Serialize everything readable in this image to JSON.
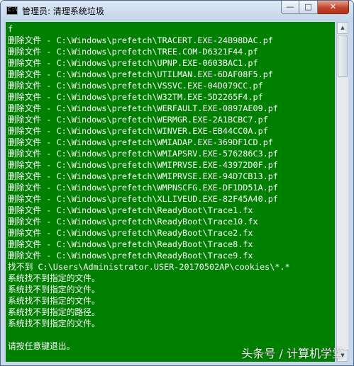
{
  "window": {
    "title": "管理员: 清理系统垃圾",
    "icon_text": "C:\\",
    "icon": "console-window-icon",
    "controls": {
      "minimize": "—",
      "maximize": "□",
      "close": "✕"
    }
  },
  "console": {
    "background_color": "#008000",
    "text_color": "#ffffff",
    "lines": [
      "f",
      "删除文件 - C:\\Windows\\prefetch\\TRACERT.EXE-24B98DAC.pf",
      "删除文件 - C:\\Windows\\prefetch\\TREE.COM-D6321F44.pf",
      "删除文件 - C:\\Windows\\prefetch\\UPNP.EXE-0603BAC1.pf",
      "删除文件 - C:\\Windows\\prefetch\\UTILMAN.EXE-6DAF08F5.pf",
      "删除文件 - C:\\Windows\\prefetch\\VSSVC.EXE-04D079CC.pf",
      "删除文件 - C:\\Windows\\prefetch\\W32TM.EXE-5D2265F4.pf",
      "删除文件 - C:\\Windows\\prefetch\\WERFAULT.EXE-0897AE09.pf",
      "删除文件 - C:\\Windows\\prefetch\\WERMGR.EXE-2A1BCBC7.pf",
      "删除文件 - C:\\Windows\\prefetch\\WINVER.EXE-EB44CC0A.pf",
      "删除文件 - C:\\Windows\\prefetch\\WMIADAP.EXE-369DF1CD.pf",
      "删除文件 - C:\\Windows\\prefetch\\WMIAPSRV.EXE-576286C3.pf",
      "删除文件 - C:\\Windows\\prefetch\\WMIPRVSE.EXE-43972D0F.pf",
      "删除文件 - C:\\Windows\\prefetch\\WMIPRVSE.EXE-94D7CB13.pf",
      "删除文件 - C:\\Windows\\prefetch\\WMPNSCFG.EXE-DF1DD51A.pf",
      "删除文件 - C:\\Windows\\prefetch\\XLLIVEUD.EXE-82F45A40.pf",
      "删除文件 - C:\\Windows\\prefetch\\ReadyBoot\\Trace1.fx",
      "删除文件 - C:\\Windows\\prefetch\\ReadyBoot\\Trace10.fx",
      "删除文件 - C:\\Windows\\prefetch\\ReadyBoot\\Trace2.fx",
      "删除文件 - C:\\Windows\\prefetch\\ReadyBoot\\Trace8.fx",
      "删除文件 - C:\\Windows\\prefetch\\ReadyBoot\\Trace9.fx",
      "找不到 C:\\Users\\Administrator.USER-20170502AP\\cookies\\*.*",
      "系统找不到指定的文件。",
      "系统找不到指定的文件。",
      "系统找不到指定的文件。",
      "系统找不到指定的路径。",
      "系统找不到指定的文件。",
      "",
      "请按任意键退出。"
    ]
  },
  "scrollbar": {
    "up_arrow": "▲",
    "down_arrow": "▼"
  },
  "watermark": {
    "text": "头条号 / 计算机学堂"
  }
}
